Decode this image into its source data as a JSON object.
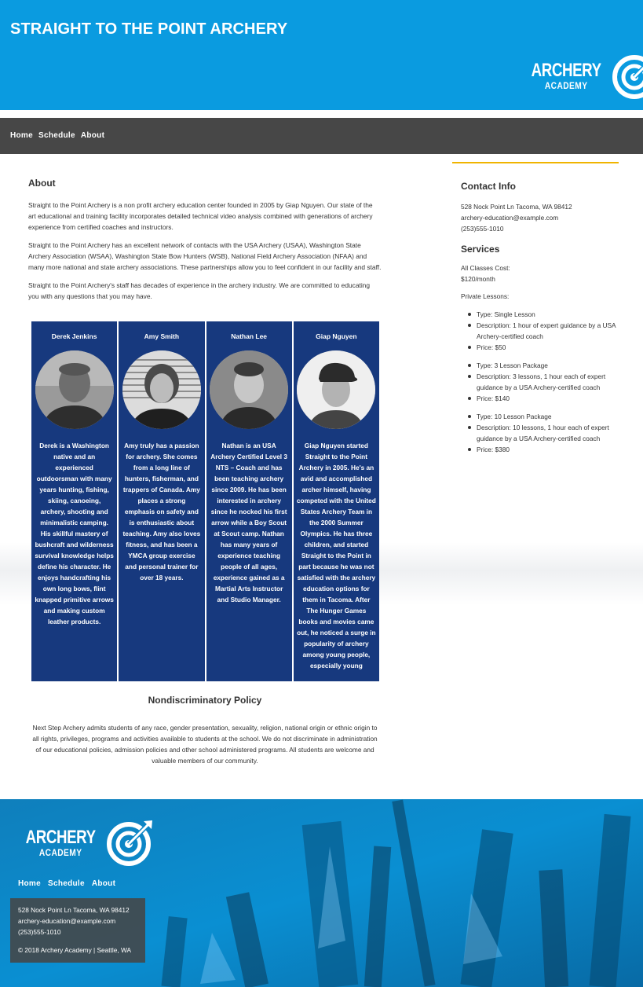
{
  "header": {
    "title": "STRAIGHT TO THE POINT ARCHERY"
  },
  "logo": {
    "line1": "ARCHERY",
    "line2": "ACADEMY",
    "icon": "target-arrow-icon"
  },
  "nav": {
    "items": [
      "Home",
      "Schedule",
      "About"
    ]
  },
  "about": {
    "heading": "About",
    "paragraphs": [
      "Straight to the Point Archery is a non profit archery education center founded in 2005 by Giap Nguyen. Our state of the art educational and training facility incorporates detailed technical video analysis combined with generations of archery experience from certified coaches and instructors.",
      "Straight to the Point Archery has an excellent network of contacts with the USA Archery (USAA), Washington State Archery Association (WSAA), Washington State Bow Hunters (WSB), National Field Archery Association (NFAA) and many more national and state archery associations. These partnerships allow you to feel confident in our facility and staff.",
      "Straight to the Point Archery's staff has decades of experience in the archery industry. We are committed to educating you with any questions that you may have."
    ]
  },
  "staff": [
    {
      "name": "Derek Jenkins",
      "bio": "Derek is a Washington native and an experienced outdoorsman with many years hunting, fishing, skiing, canoeing, archery, shooting and minimalistic camping. His skillful mastery of bushcraft and wilderness survival knowledge helps define his character. He enjoys handcrafting his own long bows, flint knapped primitive arrows and making custom leather products."
    },
    {
      "name": "Amy Smith",
      "bio": "Amy truly has a passion for archery. She comes from a long line of hunters, fisherman, and trappers of Canada. Amy places a strong emphasis on safety and is enthusiastic about teaching. Amy also loves fitness, and has been a YMCA group exercise and personal trainer for over 18 years."
    },
    {
      "name": "Nathan Lee",
      "bio": "Nathan is an USA Archery Certified Level 3 NTS – Coach and has been teaching archery since 2009. He has been interested in archery since he nocked his first arrow while a Boy Scout at Scout camp. Nathan has many years of experience teaching people of all ages, experience gained as a Martial Arts Instructor and Studio Manager."
    },
    {
      "name": "Giap Nguyen",
      "bio": "Giap Nguyen started Straight to the Point Archery in 2005. He's an avid and accomplished archer himself, having competed with the United States Archery Team in the 2000 Summer Olympics. He has three children, and started Straight to the Point in part because he was not satisfied with the archery education options for them in Tacoma. After The Hunger Games books and movies came out, he noticed a surge in popularity of archery among young people, especially young"
    }
  ],
  "policy": {
    "heading": "Nondiscriminatory Policy",
    "text": "Next Step Archery admits students of any race, gender presentation, sexuality, religion, national origin or ethnic origin to all rights, privileges, programs and activities available to students at the school. We do not discriminate in administration of our educational policies, admission policies and other school administered programs. All students are welcome and valuable members of our community."
  },
  "sidebar": {
    "contact_heading": "Contact Info",
    "address": "528 Nock Point Ln Tacoma, WA 98412",
    "email": "archery-education@example.com",
    "phone": "(253)555-1010",
    "services_heading": "Services",
    "cost_label": "All Classes Cost:",
    "cost_value": "$120/month",
    "private_label": "Private Lessons:",
    "lessons": [
      {
        "type": "Type: Single Lesson",
        "desc": "Description: 1 hour of expert guidance by a USA Archery-certified coach",
        "price": "Price: $50"
      },
      {
        "type": "Type: 3 Lesson Package",
        "desc": "Description: 3 lessons, 1 hour each of expert guidance by a USA Archery-certified coach",
        "price": "Price: $140"
      },
      {
        "type": "Type: 10 Lesson Package",
        "desc": "Description: 10 lessons, 1 hour each of expert guidance by a USA Archery-certified coach",
        "price": "Price: $380"
      }
    ]
  },
  "footer": {
    "nav": [
      "Home",
      "Schedule",
      "About"
    ],
    "address": "528 Nock Point Ln Tacoma, WA 98412",
    "email": "archery-education@example.com",
    "phone": "(253)555-1010",
    "copyright": "© 2018 Archery Academy | Seattle, WA"
  },
  "colors": {
    "header": "#0a9be0",
    "nav": "#474747",
    "staff_card": "#17397e",
    "sidebar_accent": "#f0b400"
  }
}
